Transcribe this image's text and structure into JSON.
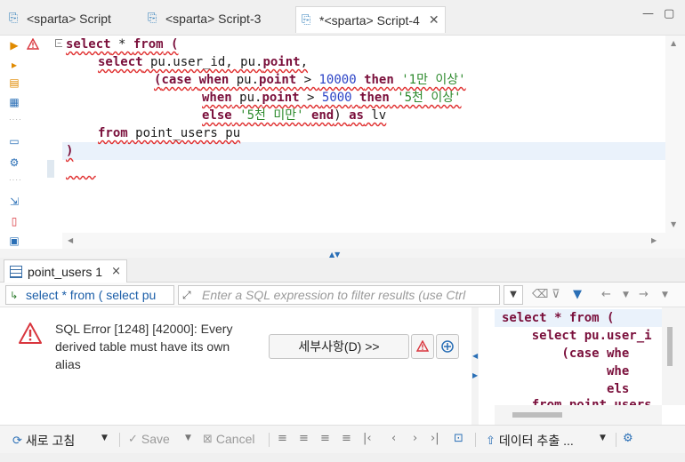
{
  "tabs": [
    {
      "label": "<sparta> Script",
      "active": false
    },
    {
      "label": "<sparta> Script-3",
      "active": false
    },
    {
      "label": "*<sparta> Script-4",
      "active": true
    }
  ],
  "window_controls": {
    "minimize": "—",
    "maximize": "▢"
  },
  "editor": {
    "lines": [
      [
        "select",
        " * ",
        "from",
        " ("
      ],
      [
        "select",
        " pu.user_id, pu.",
        "point",
        ","
      ],
      [
        "(",
        "case",
        " ",
        "when",
        " pu.",
        "point",
        " > ",
        "10000",
        " ",
        "then",
        " '1만 이상'"
      ],
      [
        "when",
        " pu.",
        "point",
        " > ",
        "5000",
        " ",
        "then",
        " '5천 이상'"
      ],
      [
        "else",
        " '5천 미만' ",
        "end",
        ") ",
        "as",
        " lv"
      ],
      [
        "from",
        " point_users pu"
      ],
      [
        ")"
      ]
    ]
  },
  "results_tab": {
    "label": "point_users 1",
    "close": "×"
  },
  "filter": {
    "query_preview": "select * from ( select pu",
    "placeholder": "Enter a SQL expression to filter results (use Ctrl"
  },
  "error": {
    "message": "SQL Error [1248] [42000]: Every derived table must have its own alias",
    "details_button": "세부사항(D) >>"
  },
  "preview_sql": [
    "select * from (",
    "    select pu.user_i",
    "        (case whe",
    "              whe",
    "              els",
    "    from point_users"
  ],
  "bottom_toolbar": {
    "refresh": "새로 고침",
    "save": "Save",
    "cancel": "Cancel",
    "export": "데이터 추출 ..."
  },
  "colors": {
    "keyword": "#7a0f3b",
    "number": "#2b43c6",
    "string": "#2d8a2d",
    "error": "#d9363e",
    "accent": "#2a6fb6"
  }
}
